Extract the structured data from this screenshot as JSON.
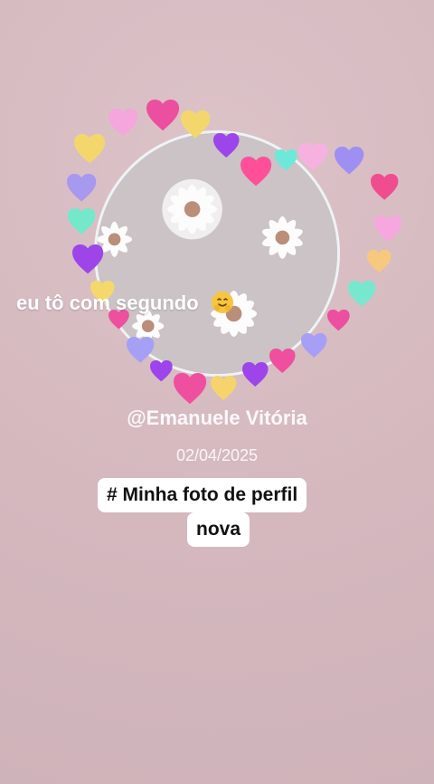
{
  "caption": {
    "text": "eu tô com segundo",
    "emoji_name": "hugging-face-icon"
  },
  "profile": {
    "username": "@Emanuele Vitória",
    "date": "02/04/2025"
  },
  "tag": {
    "line1": "# Minha foto de perfil",
    "line2": "nova"
  },
  "colors": {
    "background": "#d6bcc2",
    "caption": "#ffffff",
    "tag_bg": "#ffffff",
    "tag_text": "#111111"
  }
}
